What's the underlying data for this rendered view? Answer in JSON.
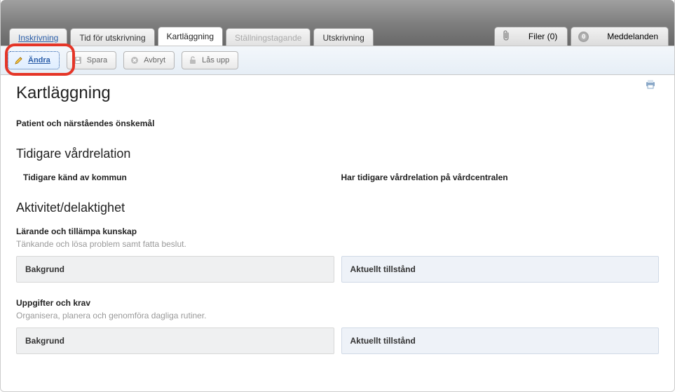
{
  "tabs": {
    "inskrivning": "Inskrivning",
    "tid": "Tid för utskrivning",
    "kartlaggning": "Kartläggning",
    "stallning": "Ställningstagande",
    "utskrivning": "Utskrivning"
  },
  "header_right": {
    "filer_label": "Filer (0)",
    "med_count": "0",
    "med_label": "Meddelanden"
  },
  "toolbar": {
    "andra": "Ändra",
    "spara": "Spara",
    "avbryt": "Avbryt",
    "lasupp": "Lås upp"
  },
  "page": {
    "title": "Kartläggning",
    "patient_label": "Patient och närståendes önskemål",
    "section_tidigare": "Tidigare vårdrelation",
    "tidigare_kommun": "Tidigare känd av kommun",
    "tidigare_vardcentral": "Har tidigare vårdrelation på vårdcentralen",
    "section_aktivitet": "Aktivitet/delaktighet",
    "larande_title": "Lärande och tillämpa kunskap",
    "larande_desc": "Tänkande och lösa problem samt fatta beslut.",
    "bakgrund": "Bakgrund",
    "aktuellt": "Aktuellt tillstånd",
    "uppgifter_title": "Uppgifter och krav",
    "uppgifter_desc": "Organisera, planera och genomföra dagliga rutiner."
  }
}
